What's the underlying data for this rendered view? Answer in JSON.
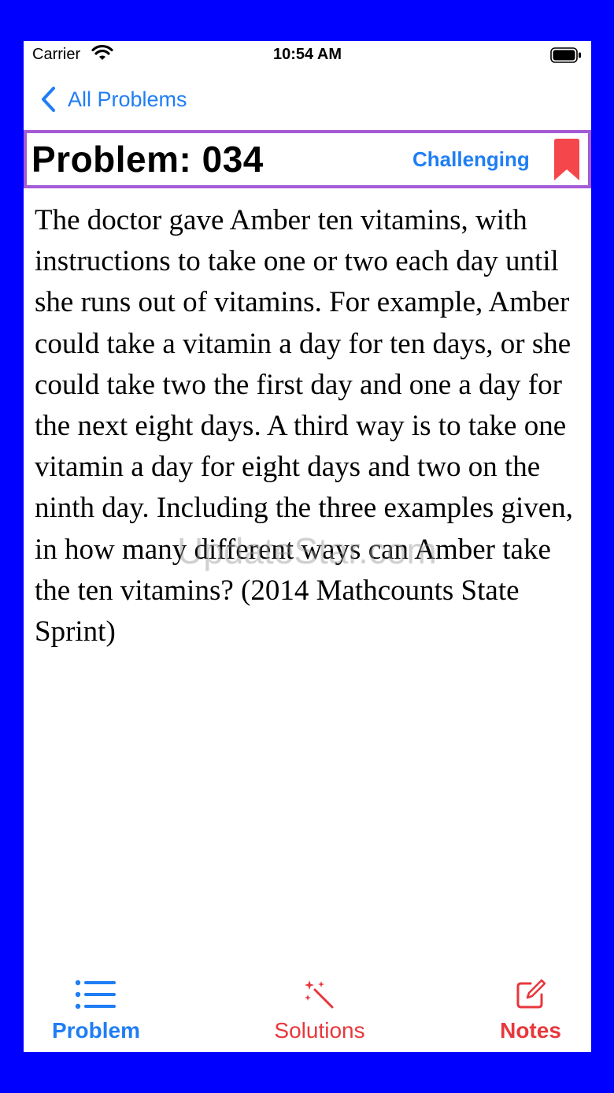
{
  "status_bar": {
    "carrier": "Carrier",
    "time": "10:54 AM"
  },
  "nav": {
    "back_label": "All Problems"
  },
  "problem": {
    "title": "Problem: 034",
    "difficulty": "Challenging",
    "text": "The doctor gave Amber ten vitamins, with instructions to take one or two each day until she runs out of vitamins. For example, Amber could take a vitamin a day for ten days, or she could take two the first day and one a day for the next eight days. A third way is to take one vitamin a day for eight days and two on the ninth day. Including the three examples given, in how many different ways can Amber take the ten vitamins? (2014 Mathcounts State Sprint)"
  },
  "watermark": "UpdateStar.com",
  "tabs": [
    {
      "label": "Problem",
      "icon": "list-icon",
      "selected": true
    },
    {
      "label": "Solutions",
      "icon": "magic-wand-icon",
      "selected": false
    },
    {
      "label": "Notes",
      "icon": "compose-icon",
      "selected": false
    }
  ],
  "colors": {
    "frame": "#0000ff",
    "accent_blue": "#1f7ef5",
    "accent_red": "#e8373c",
    "header_border": "#a45bd6",
    "bookmark": "#f5474b"
  }
}
